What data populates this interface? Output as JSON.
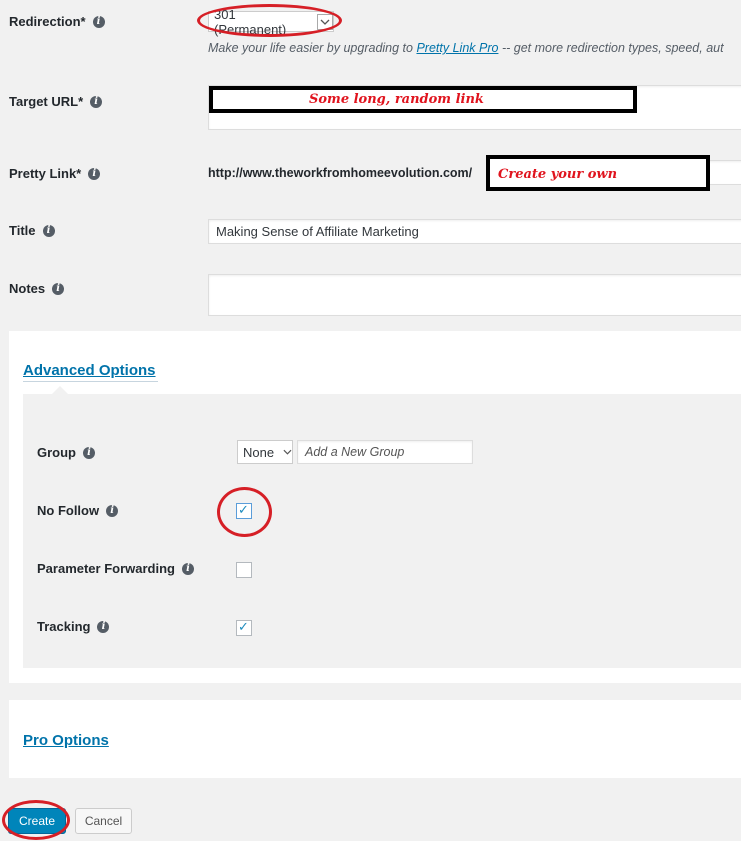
{
  "redirection": {
    "label": "Redirection*",
    "value": "301 (Permanent)",
    "help_prefix": "Make your life easier by upgrading to",
    "help_link": "Pretty Link Pro",
    "help_suffix": "-- get more redirection types, speed, aut"
  },
  "target_url": {
    "label": "Target URL*",
    "annotation": "Some long, random link"
  },
  "pretty_link": {
    "label": "Pretty Link*",
    "base_url": "http://www.theworkfromhomeevolution.com/",
    "annotation": "Create your own"
  },
  "title_field": {
    "label": "Title",
    "value": "Making Sense of Affiliate Marketing"
  },
  "notes": {
    "label": "Notes",
    "value": ""
  },
  "advanced": {
    "heading": "Advanced Options",
    "group": {
      "label": "Group",
      "value": "None",
      "placeholder": "Add a New Group"
    },
    "no_follow": {
      "label": "No Follow",
      "checked": true
    },
    "param_forwarding": {
      "label": "Parameter Forwarding",
      "checked": false
    },
    "tracking": {
      "label": "Tracking",
      "checked": true
    }
  },
  "pro": {
    "heading": "Pro Options"
  },
  "buttons": {
    "create": "Create",
    "cancel": "Cancel"
  },
  "colors": {
    "accent": "#0073aa",
    "primary_button": "#0085ba",
    "annotation_red": "#d61f26"
  }
}
